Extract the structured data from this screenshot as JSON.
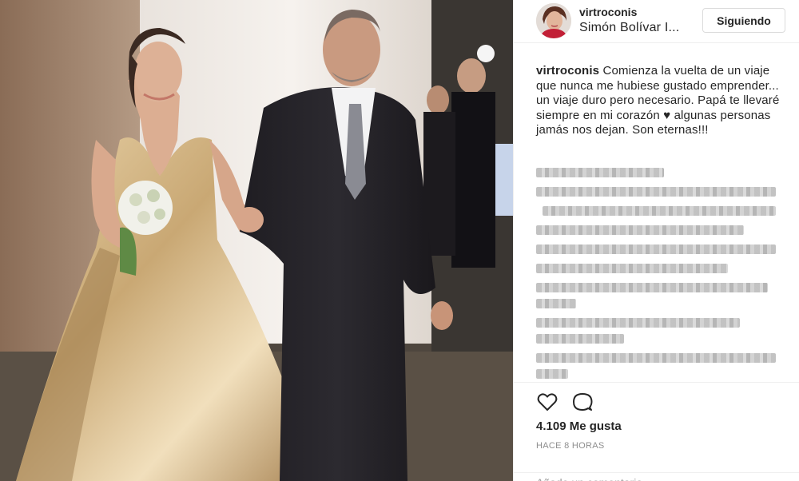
{
  "post": {
    "username": "virtroconis",
    "location": "Simón Bolívar I...",
    "follow_label": "Siguiendo",
    "caption_user": "virtroconis",
    "caption_text": "Comienza la vuelta de un viaje que nunca me hubiese gustado emprender... un viaje duro pero necesario. Papá te llevaré siempre en mi corazón ♥ algunas personas jamás nos dejan. Son eternas!!!",
    "likes": "4.109 Me gusta",
    "timestamp": "HACE 8 HORAS",
    "comment_placeholder": "Añade un comentario..."
  },
  "icons": {
    "like": "heart-icon",
    "comment": "comment-icon"
  },
  "colors": {
    "text": "#262626",
    "muted": "#8e8e8e",
    "border": "#efefef"
  }
}
